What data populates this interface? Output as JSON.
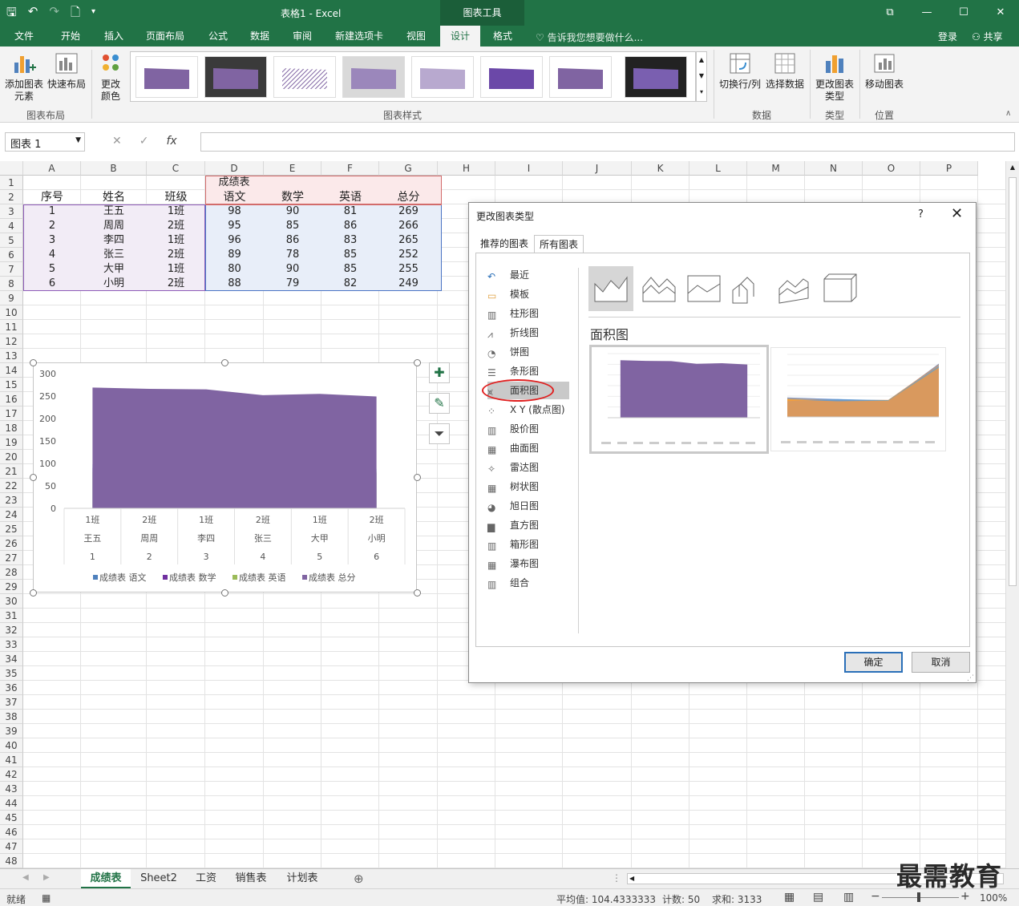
{
  "titlebar": {
    "title": "表格1 - Excel",
    "chart_tools": "图表工具"
  },
  "tabs": [
    "文件",
    "开始",
    "插入",
    "页面布局",
    "公式",
    "数据",
    "审阅",
    "新建选项卡",
    "视图",
    "设计",
    "格式"
  ],
  "tell_me": "告诉我您想要做什么...",
  "login": "登录",
  "share": "共享",
  "ribbon": {
    "add_element": "添加图表元素",
    "quick_layout": "快速布局",
    "change_color": "更改颜色",
    "group_layout": "图表布局",
    "group_styles": "图表样式",
    "switch_row_col": "切换行/列",
    "select_data": "选择数据",
    "group_data": "数据",
    "change_type": "更改图表类型",
    "group_type": "类型",
    "move_chart": "移动图表",
    "group_location": "位置"
  },
  "namebox": "图表 1",
  "columns": [
    "A",
    "B",
    "C",
    "D",
    "E",
    "F",
    "G",
    "H",
    "I",
    "J",
    "K",
    "L",
    "M",
    "N",
    "O",
    "P"
  ],
  "sheet": {
    "title": "成绩表",
    "headers": [
      "序号",
      "姓名",
      "班级",
      "语文",
      "数学",
      "英语",
      "总分"
    ],
    "rows": [
      [
        "1",
        "王五",
        "1班",
        "98",
        "90",
        "81",
        "269"
      ],
      [
        "2",
        "周周",
        "2班",
        "95",
        "85",
        "86",
        "266"
      ],
      [
        "3",
        "李四",
        "1班",
        "96",
        "86",
        "83",
        "265"
      ],
      [
        "4",
        "张三",
        "2班",
        "89",
        "78",
        "85",
        "252"
      ],
      [
        "5",
        "大甲",
        "1班",
        "80",
        "90",
        "85",
        "255"
      ],
      [
        "6",
        "小明",
        "2班",
        "88",
        "79",
        "82",
        "249"
      ]
    ]
  },
  "chart_data": {
    "type": "area",
    "categories": [
      [
        "1班",
        "王五",
        "1"
      ],
      [
        "2班",
        "周周",
        "2"
      ],
      [
        "1班",
        "李四",
        "3"
      ],
      [
        "2班",
        "张三",
        "4"
      ],
      [
        "1班",
        "大甲",
        "5"
      ],
      [
        "2班",
        "小明",
        "6"
      ]
    ],
    "series": [
      {
        "name": "成绩表 语文",
        "color": "#4f81bd",
        "values": [
          98,
          95,
          96,
          89,
          80,
          88
        ]
      },
      {
        "name": "成绩表 数学",
        "color": "#7030a0",
        "values": [
          90,
          85,
          86,
          78,
          90,
          79
        ]
      },
      {
        "name": "成绩表 英语",
        "color": "#9bbb59",
        "values": [
          81,
          86,
          83,
          85,
          85,
          82
        ]
      },
      {
        "name": "成绩表 总分",
        "color": "#8064a2",
        "values": [
          269,
          266,
          265,
          252,
          255,
          249
        ]
      }
    ],
    "yticks": [
      0,
      50,
      100,
      150,
      200,
      250,
      300
    ],
    "ylim": [
      0,
      300
    ],
    "legend_position": "bottom"
  },
  "dialog": {
    "title": "更改图表类型",
    "help": "?",
    "tabs": [
      "推荐的图表",
      "所有图表"
    ],
    "types": [
      "最近",
      "模板",
      "柱形图",
      "折线图",
      "饼图",
      "条形图",
      "面积图",
      "X Y (散点图)",
      "股价图",
      "曲面图",
      "雷达图",
      "树状图",
      "旭日图",
      "直方图",
      "箱形图",
      "瀑布图",
      "组合"
    ],
    "selected_type": "面积图",
    "section_title": "面积图",
    "ok": "确定",
    "cancel": "取消"
  },
  "sheet_tabs": [
    "成绩表",
    "Sheet2",
    "工资",
    "销售表",
    "计划表"
  ],
  "status": {
    "ready": "就绪",
    "average": "平均值: 104.4333333",
    "count": "计数: 50",
    "sum": "求和: 3133",
    "zoom": "100%"
  },
  "watermark": "最需教育",
  "colors": {
    "excel_green": "#217346",
    "area_purple": "#8064a2"
  }
}
